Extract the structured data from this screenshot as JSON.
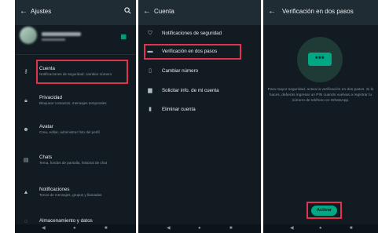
{
  "panel1": {
    "back_icon": "arrow-left-icon",
    "title": "Ajustes",
    "search_icon": "search-icon",
    "qr_icon": "qr-code-icon",
    "items": [
      {
        "title": "Cuenta",
        "subtitle": "Notificaciones de seguridad, cambiar número",
        "icon": "key-icon"
      },
      {
        "title": "Privacidad",
        "subtitle": "Bloquear contactos, mensajes temporales",
        "icon": "lock-icon"
      },
      {
        "title": "Avatar",
        "subtitle": "Crea, editar, administrar foto del perfil",
        "icon": "avatar-icon"
      },
      {
        "title": "Chats",
        "subtitle": "Tema, fondos de pantalla, historial de chat",
        "icon": "chat-icon"
      },
      {
        "title": "Notificaciones",
        "subtitle": "Tonos de mensajes, grupos y llamadas",
        "icon": "bell-icon"
      },
      {
        "title": "Almacenamiento y datos",
        "subtitle": "",
        "icon": "storage-icon"
      }
    ]
  },
  "panel2": {
    "back_icon": "arrow-left-icon",
    "title": "Cuenta",
    "items": [
      {
        "label": "Notificaciones de seguridad",
        "icon": "shield-icon"
      },
      {
        "label": "Verificación en dos pasos",
        "icon": "pin-icon"
      },
      {
        "label": "Cambiar número",
        "icon": "phone-swap-icon"
      },
      {
        "label": "Solicitar info. de mi cuenta",
        "icon": "document-icon"
      },
      {
        "label": "Eliminar cuenta",
        "icon": "trash-icon"
      }
    ]
  },
  "panel3": {
    "back_icon": "arrow-left-icon",
    "title": "Verificación en dos pasos",
    "pin_glyph": "***",
    "description": "Para mayor seguridad, activa la verificación en dos pasos. Si lo haces, deberás ingresar un PIN cuando vuelvas a registrar tu número de teléfono en WhatsApp.",
    "activate_label": "Activar"
  },
  "colors": {
    "background": "#111b21",
    "app_bar": "#202c33",
    "accent": "#00a884",
    "highlight": "#e0344e"
  }
}
